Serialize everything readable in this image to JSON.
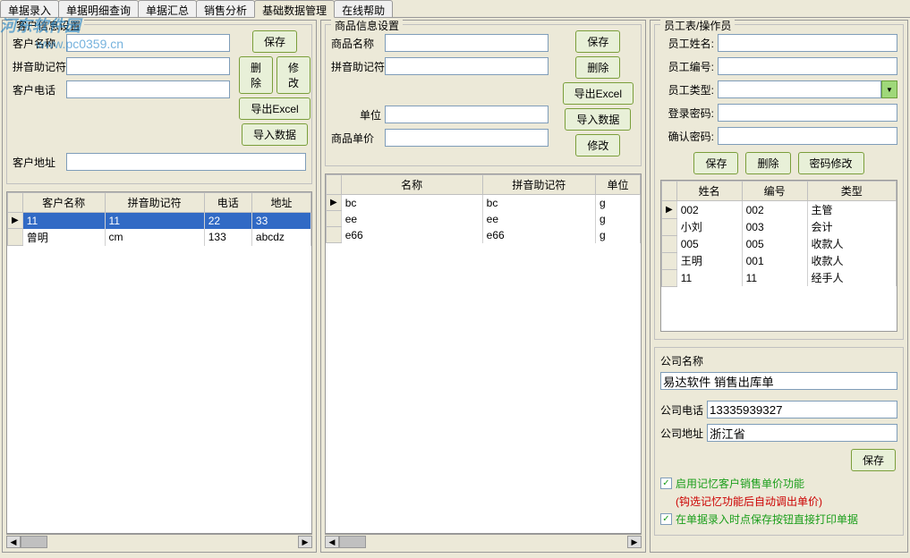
{
  "tabs": [
    "单据录入",
    "单据明细查询",
    "单据汇总",
    "销售分析",
    "基础数据管理",
    "在线帮助"
  ],
  "watermark": {
    "logo": "河东软件园",
    "url": "www.pc0359.cn"
  },
  "panel1": {
    "title": "客户信息设置",
    "labels": {
      "name": "客户名称",
      "pinyin": "拼音助记符",
      "phone": "客户电话",
      "addr": "客户地址"
    },
    "buttons": {
      "save": "保存",
      "delete": "删除",
      "modify": "修改",
      "export": "导出Excel",
      "import": "导入数据"
    },
    "headers": [
      "客户名称",
      "拼音助记符",
      "电话",
      "地址"
    ],
    "rows": [
      {
        "name": "11",
        "pinyin": "11",
        "phone": "22",
        "addr": "33",
        "selected": true
      },
      {
        "name": "曾明",
        "pinyin": "cm",
        "phone": "133",
        "addr": "abcdz",
        "selected": false
      }
    ]
  },
  "panel2": {
    "title": "商品信息设置",
    "labels": {
      "name": "商品名称",
      "pinyin": "拼音助记符",
      "unit": "单位",
      "price": "商品单价"
    },
    "buttons": {
      "save": "保存",
      "delete": "删除",
      "export": "导出Excel",
      "import": "导入数据",
      "modify": "修改"
    },
    "headers": [
      "名称",
      "拼音助记符",
      "单位"
    ],
    "rows": [
      {
        "name": "bc",
        "pinyin": "bc",
        "unit": "g"
      },
      {
        "name": "ee",
        "pinyin": "ee",
        "unit": "g"
      },
      {
        "name": "e66",
        "pinyin": "e66",
        "unit": "g"
      }
    ]
  },
  "panel3": {
    "title": "员工表/操作员",
    "labels": {
      "name": "员工姓名:",
      "id": "员工编号:",
      "type": "员工类型:",
      "pwd": "登录密码:",
      "pwd2": "确认密码:"
    },
    "buttons": {
      "save": "保存",
      "delete": "删除",
      "pwdmod": "密码修改"
    },
    "headers": [
      "姓名",
      "编号",
      "类型"
    ],
    "rows": [
      {
        "name": "002",
        "id": "002",
        "type": "主管"
      },
      {
        "name": "小刘",
        "id": "003",
        "type": "会计"
      },
      {
        "name": "005",
        "id": "005",
        "type": "收款人"
      },
      {
        "name": "王明",
        "id": "001",
        "type": "收款人"
      },
      {
        "name": "11",
        "id": "11",
        "type": "经手人"
      }
    ],
    "company": {
      "title": "公司名称",
      "name": "易达软件 销售出库单",
      "phone_label": "公司电话",
      "phone": "13335939327",
      "addr_label": "公司地址",
      "addr": "浙江省",
      "save": "保存"
    },
    "options": {
      "opt1": "启用记忆客户销售单价功能",
      "opt1_note": "(钩选记忆功能后自动调出单价)",
      "opt2": "在单据录入时点保存按钮直接打印单据"
    }
  }
}
